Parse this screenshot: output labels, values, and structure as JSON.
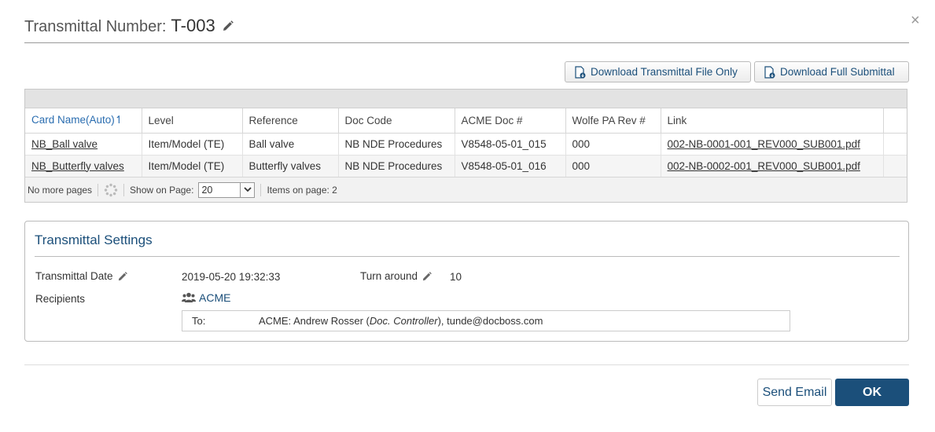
{
  "dialog": {
    "close_glyph": "×",
    "title_label": "Transmittal Number:",
    "title_value": "T-003",
    "edit_icon": "pencil-icon"
  },
  "toolbar": {
    "download_file_label": "Download Transmittal File Only",
    "download_full_label": "Download Full Submittal"
  },
  "table": {
    "columns": [
      "Card Name(Auto)↿",
      "Level",
      "Reference",
      "Doc Code",
      "ACME Doc #",
      "Wolfe PA Rev #",
      "Link"
    ],
    "rows": [
      [
        "NB_Ball valve",
        "Item/Model (TE)",
        "Ball valve",
        "NB NDE Procedures",
        "V8548-05-01_015",
        "000",
        "002-NB-0001-001_REV000_SUB001.pdf"
      ],
      [
        "NB_Butterfly valves",
        "Item/Model (TE)",
        "Butterfly valves",
        "NB NDE Procedures",
        "V8548-05-01_016",
        "000",
        "002-NB-0002-001_REV000_SUB001.pdf"
      ]
    ]
  },
  "pager": {
    "no_more_pages": "No more pages",
    "show_on_page_label": "Show on Page:",
    "show_on_page_value": "20",
    "items_on_page": "Items on page: 2"
  },
  "settings": {
    "title": "Transmittal Settings",
    "transmittal_date_label": "Transmittal Date",
    "transmittal_date_value": "2019-05-20 19:32:33",
    "turn_around_label": "Turn around",
    "turn_around_value": "10",
    "recipients_label": "Recipients",
    "recipient_group": "ACME",
    "to_label": "To:",
    "to_prefix": "ACME: Andrew Rosser (",
    "to_role": "Doc. Controller",
    "to_suffix": "), tunde@docboss.com"
  },
  "footer": {
    "send_email_label": "Send Email",
    "ok_label": "OK"
  },
  "colors": {
    "accent": "#1b4f7a",
    "link": "#2a6db0"
  }
}
